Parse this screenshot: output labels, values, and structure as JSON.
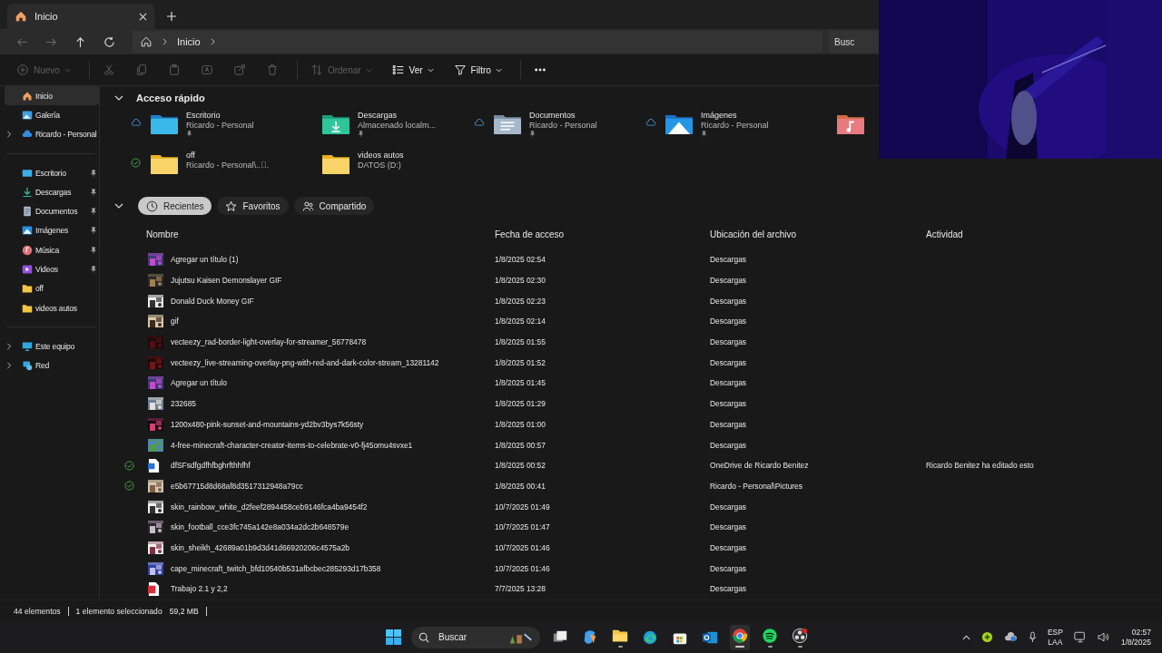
{
  "tab": {
    "title": "Inicio",
    "selected": true
  },
  "nav": {
    "back_disabled": true,
    "forward_disabled": true
  },
  "breadcrumb": [
    "Inicio"
  ],
  "search": {
    "placeholder": "Busc"
  },
  "toolbar": [
    {
      "kind": "new",
      "label": "Nuevo",
      "disabled": true
    },
    {
      "kind": "cut",
      "disabled": true
    },
    {
      "kind": "copy",
      "disabled": true
    },
    {
      "kind": "paste",
      "disabled": true
    },
    {
      "kind": "rename",
      "disabled": true
    },
    {
      "kind": "share",
      "disabled": true
    },
    {
      "kind": "delete",
      "disabled": true
    },
    {
      "kind": "sort",
      "label": "Ordenar",
      "disabled": true
    },
    {
      "kind": "view",
      "label": "Ver",
      "disabled": false
    },
    {
      "kind": "filter",
      "label": "Filtro",
      "disabled": false
    },
    {
      "kind": "more",
      "disabled": false
    }
  ],
  "sidebar": {
    "groups": [
      [
        {
          "kind": "home",
          "label": "Inicio",
          "selected": true,
          "pinned": false,
          "expandable": false
        },
        {
          "kind": "gallery",
          "label": "Galería",
          "selected": false,
          "pinned": false,
          "expandable": false
        },
        {
          "kind": "cloud",
          "label": "Ricardo - Personal",
          "selected": false,
          "pinned": false,
          "expandable": true
        }
      ],
      [
        {
          "kind": "desktop",
          "label": "Escritorio",
          "selected": false,
          "pinned": true,
          "expandable": false
        },
        {
          "kind": "download",
          "label": "Descargas",
          "selected": false,
          "pinned": true,
          "expandable": false
        },
        {
          "kind": "docs",
          "label": "Documentos",
          "selected": false,
          "pinned": true,
          "expandable": false
        },
        {
          "kind": "images",
          "label": "Imágenes",
          "selected": false,
          "pinned": true,
          "expandable": false
        },
        {
          "kind": "music",
          "label": "Música",
          "selected": false,
          "pinned": true,
          "expandable": false
        },
        {
          "kind": "videos",
          "label": "Videos",
          "selected": false,
          "pinned": true,
          "expandable": false
        },
        {
          "kind": "folder",
          "label": "off",
          "selected": false,
          "pinned": false,
          "expandable": false
        },
        {
          "kind": "folder",
          "label": "videos autos",
          "selected": false,
          "pinned": false,
          "expandable": false
        }
      ],
      [
        {
          "kind": "pc",
          "label": "Este equipo",
          "selected": false,
          "pinned": false,
          "expandable": true
        },
        {
          "kind": "network",
          "label": "Red",
          "selected": false,
          "pinned": false,
          "expandable": true
        }
      ]
    ]
  },
  "quick_access": {
    "title": "Acceso rápido",
    "expanded": true,
    "items": [
      {
        "kind": "desktop",
        "cloud": true,
        "synced": false,
        "name": "Escritorio",
        "sub": "Ricardo - Personal",
        "pinned": true
      },
      {
        "kind": "download",
        "cloud": false,
        "synced": false,
        "name": "Descargas",
        "sub": "Almacenado localm...",
        "pinned": true
      },
      {
        "kind": "docs",
        "cloud": true,
        "synced": false,
        "name": "Documentos",
        "sub": "Ricardo - Personal",
        "pinned": true
      },
      {
        "kind": "images",
        "cloud": true,
        "synced": false,
        "name": "Imágenes",
        "sub": "Ricardo - Personal",
        "pinned": true
      },
      {
        "kind": "music"
      },
      {
        "kind": "folder",
        "cloud": false,
        "synced": true,
        "name": "off",
        "sub": "Ricardo - Personal\\...ُ",
        "pinned": false
      },
      {
        "kind": "folder",
        "cloud": false,
        "synced": false,
        "name": "videos autos",
        "sub": "DATOS (D:)",
        "pinned": false
      }
    ]
  },
  "filters": {
    "expanded": true,
    "items": [
      {
        "kind": "clock",
        "label": "Recientes",
        "selected": true
      },
      {
        "kind": "star",
        "label": "Favoritos",
        "selected": false
      },
      {
        "kind": "people",
        "label": "Compartido",
        "selected": false
      }
    ]
  },
  "table": {
    "columns": [
      "Nombre",
      "Fecha de acceso",
      "Ubicación del archivo",
      "Actividad"
    ],
    "rows": [
      {
        "kind": "picture",
        "synced": false,
        "name": "Agregar un título (1)",
        "date": "1/8/2025 02:54",
        "location": "Descargas"
      },
      {
        "kind": "picture",
        "synced": false,
        "name": "Jujutsu Kaisen Demonslayer GIF",
        "date": "1/8/2025 02:30",
        "location": "Descargas"
      },
      {
        "kind": "picture",
        "synced": false,
        "name": "Donald Duck Money GIF",
        "date": "1/8/2025 02:23",
        "location": "Descargas"
      },
      {
        "kind": "picture",
        "synced": false,
        "name": "gif",
        "date": "1/8/2025 02:14",
        "location": "Descargas"
      },
      {
        "kind": "picture",
        "synced": false,
        "name": "vecteezy_rad-border-light-overlay-for-streamer_56778478",
        "date": "1/8/2025 01:55",
        "location": "Descargas"
      },
      {
        "kind": "picture",
        "synced": false,
        "name": "vecteezy_live-streaming-overlay-png-with-red-and-dark-color-stream_13281142",
        "date": "1/8/2025 01:52",
        "location": "Descargas"
      },
      {
        "kind": "picture",
        "synced": false,
        "name": "Agregar un título",
        "date": "1/8/2025 01:45",
        "location": "Descargas"
      },
      {
        "kind": "picture",
        "synced": false,
        "name": "232685",
        "date": "1/8/2025 01:29",
        "location": "Descargas"
      },
      {
        "kind": "picture",
        "synced": false,
        "name": "1200x480-pink-sunset-and-mountains-yd2bv3bys7k56sty",
        "date": "1/8/2025 01:00",
        "location": "Descargas"
      },
      {
        "kind": "picture",
        "synced": false,
        "name": "4-free-minecraft-character-creator-items-to-celebrate-v0-fj45omu4svxe1",
        "date": "1/8/2025 00:57",
        "location": "Descargas"
      },
      {
        "kind": "word",
        "synced": true,
        "name": "dfSFsdfgdfhfbghrfthhfhf",
        "date": "1/8/2025 00:52",
        "location": "OneDrive de Ricardo Benitez",
        "activity": "Ricardo Benitez ha editado esto"
      },
      {
        "kind": "picture",
        "synced": true,
        "name": "e5b67715d8d68af8d3517312948a79cc",
        "date": "1/8/2025 00:41",
        "location": "Ricardo - Personal\\Pictures"
      },
      {
        "kind": "picture",
        "synced": false,
        "name": "skin_rainbow_white_d2feef2894458ceb9146fca4ba9454f2",
        "date": "10/7/2025 01:49",
        "location": "Descargas"
      },
      {
        "kind": "picture",
        "synced": false,
        "name": "skin_football_cce3fc745a142e8a034a2dc2b648579e",
        "date": "10/7/2025 01:47",
        "location": "Descargas"
      },
      {
        "kind": "picture",
        "synced": false,
        "name": "skin_sheikh_42689a01b9d3d41d66920206c4575a2b",
        "date": "10/7/2025 01:46",
        "location": "Descargas"
      },
      {
        "kind": "picture",
        "synced": false,
        "name": "cape_minecraft_twitch_bfd10540b531afbcbec285293d17b358",
        "date": "10/7/2025 01:46",
        "location": "Descargas"
      },
      {
        "kind": "pdf",
        "synced": false,
        "name": "Trabajo 2.1 y 2,2",
        "date": "7/7/2025 13:28",
        "location": "Descargas"
      }
    ]
  },
  "status_bar": [
    "44 elementos",
    "1 elemento seleccionado",
    "59,2 MB"
  ],
  "camera_overlay": {
    "kind": "picture"
  },
  "taskbar": {
    "search": {
      "placeholder": "Buscar"
    },
    "apps": [
      {
        "kind": "taskview",
        "running": false,
        "active": false
      },
      {
        "kind": "copilot",
        "running": false,
        "active": false
      },
      {
        "kind": "explorer",
        "running": true,
        "active": false
      },
      {
        "kind": "edge",
        "running": false,
        "active": false
      },
      {
        "kind": "store",
        "running": false,
        "active": false
      },
      {
        "kind": "outlook",
        "running": false,
        "active": false
      },
      {
        "kind": "chrome",
        "running": true,
        "active": true
      },
      {
        "kind": "spotify",
        "running": true,
        "active": false
      },
      {
        "kind": "obs",
        "running": true,
        "active": false
      }
    ],
    "language": [
      "ESP",
      "LAA"
    ],
    "time": "02:57",
    "date": "1/8/2025"
  }
}
